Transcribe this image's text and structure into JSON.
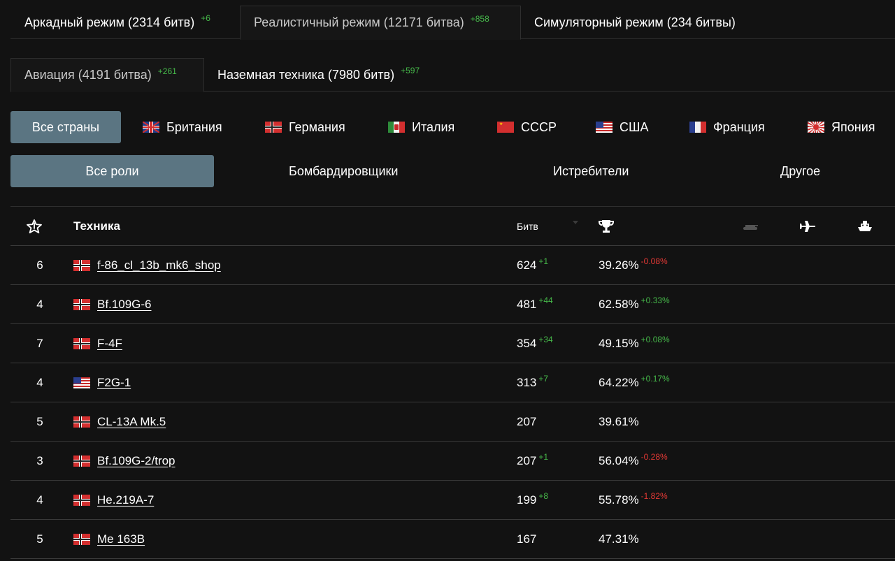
{
  "mode_tabs": [
    {
      "label": "Аркадный режим (2314 битв)",
      "delta": "+6",
      "active": false
    },
    {
      "label": "Реалистичный режим (12171 битва)",
      "delta": "+858",
      "active": true
    },
    {
      "label": "Симуляторный режим (234 битвы)",
      "delta": "",
      "active": false
    }
  ],
  "branch_tabs": [
    {
      "label": "Авиация (4191 битва)",
      "delta": "+261",
      "active": true
    },
    {
      "label": "Наземная техника (7980 битв)",
      "delta": "+597",
      "active": false
    }
  ],
  "countries": {
    "all_label": "Все страны",
    "items": [
      {
        "label": "Британия",
        "flag": "uk-flag-icon"
      },
      {
        "label": "Германия",
        "flag": "germany-flag-icon"
      },
      {
        "label": "Италия",
        "flag": "italy-flag-icon"
      },
      {
        "label": "СССР",
        "flag": "ussr-flag-icon"
      },
      {
        "label": "США",
        "flag": "usa-flag-icon"
      },
      {
        "label": "Франция",
        "flag": "france-flag-icon"
      },
      {
        "label": "Япония",
        "flag": "japan-flag-icon"
      }
    ]
  },
  "roles": {
    "all_label": "Все роли",
    "items": [
      "Бомбардировщики",
      "Истребители",
      "Другое"
    ]
  },
  "table": {
    "headers": {
      "rank_icon": "rank-star-icon",
      "vehicle": "Техника",
      "battles": "Битв",
      "winrate_icon": "trophy-icon",
      "extra_icons": [
        "tank-icon",
        "plane-icon",
        "ship-icon"
      ]
    },
    "rows": [
      {
        "rank": "6",
        "flag": "germany-flag-icon",
        "name": "f-86_cl_13b_mk6_shop",
        "battles": "624",
        "battles_delta": "+1",
        "winrate": "39.26%",
        "winrate_delta": "-0.08%",
        "winrate_delta_sign": "neg"
      },
      {
        "rank": "4",
        "flag": "germany-flag-icon",
        "name": "Bf.109G-6",
        "battles": "481",
        "battles_delta": "+44",
        "winrate": "62.58%",
        "winrate_delta": "+0.33%",
        "winrate_delta_sign": "pos"
      },
      {
        "rank": "7",
        "flag": "germany-flag-icon",
        "name": "F-4F",
        "battles": "354",
        "battles_delta": "+34",
        "winrate": "49.15%",
        "winrate_delta": "+0.08%",
        "winrate_delta_sign": "pos"
      },
      {
        "rank": "4",
        "flag": "usa-flag-icon",
        "name": "F2G-1",
        "battles": "313",
        "battles_delta": "+7",
        "winrate": "64.22%",
        "winrate_delta": "+0.17%",
        "winrate_delta_sign": "pos"
      },
      {
        "rank": "5",
        "flag": "germany-flag-icon",
        "name": "CL-13A Mk.5",
        "battles": "207",
        "battles_delta": "",
        "winrate": "39.61%",
        "winrate_delta": "",
        "winrate_delta_sign": ""
      },
      {
        "rank": "3",
        "flag": "germany-flag-icon",
        "name": "Bf.109G-2/trop",
        "battles": "207",
        "battles_delta": "+1",
        "winrate": "56.04%",
        "winrate_delta": "-0.28%",
        "winrate_delta_sign": "neg"
      },
      {
        "rank": "4",
        "flag": "germany-flag-icon",
        "name": "He.219A-7",
        "battles": "199",
        "battles_delta": "+8",
        "winrate": "55.78%",
        "winrate_delta": "-1.82%",
        "winrate_delta_sign": "neg"
      },
      {
        "rank": "5",
        "flag": "germany-flag-icon",
        "name": "Me 163B",
        "battles": "167",
        "battles_delta": "",
        "winrate": "47.31%",
        "winrate_delta": "",
        "winrate_delta_sign": ""
      }
    ]
  },
  "colors": {
    "background": "#121212",
    "accent_button": "#5b7582",
    "positive": "#46b94a",
    "negative": "#e53935"
  }
}
